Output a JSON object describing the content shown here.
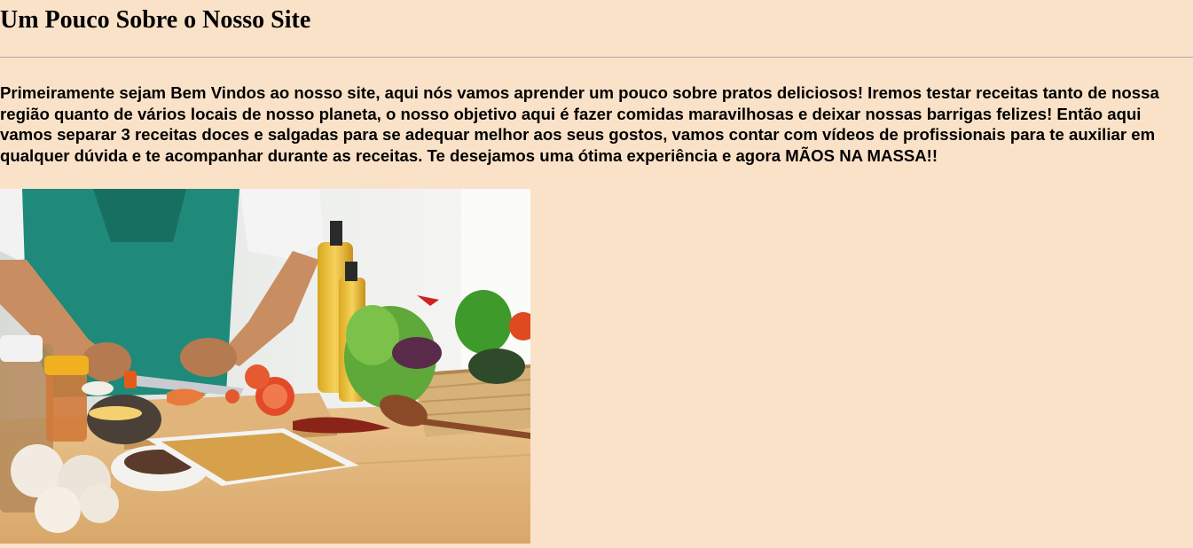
{
  "page": {
    "title": "Um Pouco Sobre o Nosso Site",
    "intro": "Primeiramente sejam Bem Vindos ao nosso site, aqui nós vamos aprender um pouco sobre pratos deliciosos! Iremos testar receitas tanto de nossa região quanto de vários locais de nosso planeta, o nosso objetivo aqui é fazer comidas maravilhosas e deixar nossas barrigas felizes! Então aqui vamos separar 3 receitas doces e salgadas para se adequar melhor aos seus gostos, vamos contar com vídeos de profissionais para te auxiliar em qualquer dúvida e te acompanhar durante as receitas. Te desejamos uma ótima experiência e agora MÃOS NA MASSA!!"
  },
  "colors": {
    "background": "#fae2c8",
    "divider": "#a9a9a9",
    "text": "#000000"
  }
}
